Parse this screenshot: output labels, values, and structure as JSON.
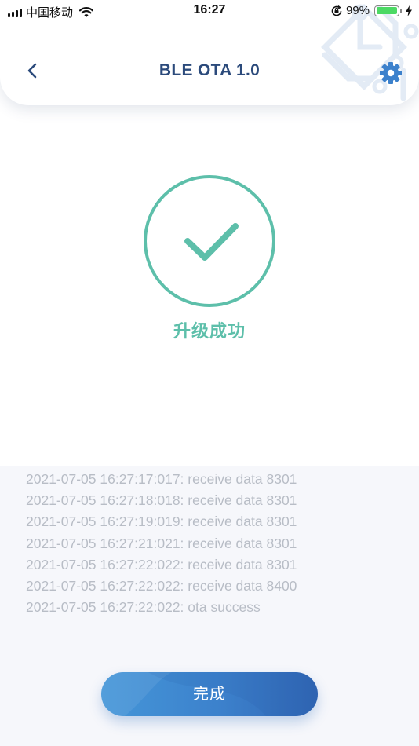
{
  "status_bar": {
    "carrier": "中国移动",
    "time": "16:27",
    "battery_percent": "99%",
    "battery_level": 0.99
  },
  "header": {
    "title": "BLE OTA 1.0",
    "back_icon": "chevron-left-icon",
    "settings_icon": "gear-icon"
  },
  "result": {
    "icon": "check-circle-icon",
    "text": "升级成功"
  },
  "log": [
    "2021-07-05 16:27:17:017: receive data 8301",
    "2021-07-05 16:27:18:018: receive data 8301",
    "2021-07-05 16:27:19:019: receive data 8301",
    "2021-07-05 16:27:21:021: receive data 8301",
    "2021-07-05 16:27:22:022: receive data 8301",
    "2021-07-05 16:27:22:022: receive data 8400",
    "2021-07-05 16:27:22:022: ota success"
  ],
  "done_button": {
    "label": "完成"
  },
  "colors": {
    "title": "#2b4a7b",
    "accent_blue": "#3c81cc",
    "success_green": "#5dbfaa",
    "log_text": "#b8bdc6",
    "log_background": "#f6f7fb"
  }
}
